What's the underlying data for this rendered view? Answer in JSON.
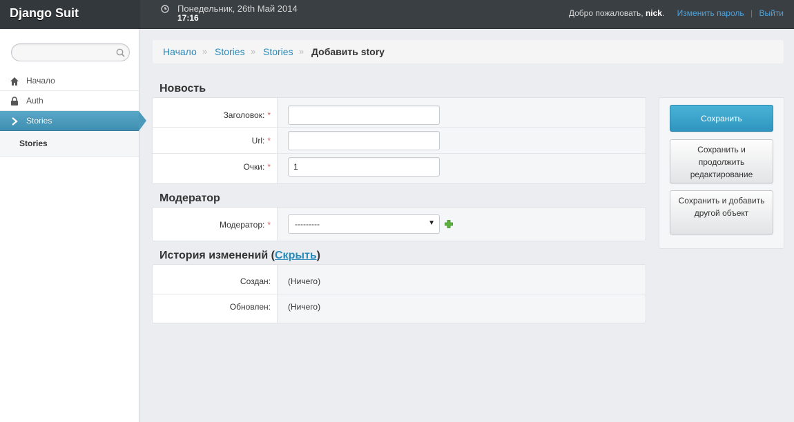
{
  "header": {
    "brand": "Django Suit",
    "date": "Понедельник, 26th Май 2014",
    "time": "17:16",
    "welcome": "Добро пожаловать,",
    "username": "nick",
    "change_password": "Изменить пароль",
    "separator": "|",
    "logout": "Выйти"
  },
  "sidebar": {
    "search_placeholder": "",
    "items": [
      {
        "label": "Начало",
        "icon": "home-icon"
      },
      {
        "label": "Auth",
        "icon": "lock-icon"
      },
      {
        "label": "Stories",
        "icon": "chevron-right-icon"
      }
    ],
    "sub_items": [
      {
        "label": "Stories"
      }
    ]
  },
  "breadcrumb": {
    "items": [
      "Начало",
      "Stories",
      "Stories"
    ],
    "separator": "»",
    "current": "Добавить story"
  },
  "fieldsets": {
    "news": {
      "title": "Новость",
      "fields": [
        {
          "label": "Заголовок:",
          "value": ""
        },
        {
          "label": "Url:",
          "value": ""
        },
        {
          "label": "Очки:",
          "value": "1"
        }
      ]
    },
    "moderator": {
      "title": "Модератор",
      "field_label": "Модератор:",
      "selected": "---------"
    },
    "history": {
      "title": "История изменений",
      "toggle_link": "Скрыть",
      "rows": [
        {
          "label": "Создан:",
          "value": "(Ничего)"
        },
        {
          "label": "Обновлен:",
          "value": "(Ничего)"
        }
      ]
    },
    "required_marker": "*"
  },
  "actions": {
    "save": "Сохранить",
    "save_continue": "Сохранить и продолжить редактирование",
    "save_add": "Сохранить и добавить другой объект"
  },
  "colors": {
    "header_bg": "#3a3f44",
    "accent": "#2a8ab9",
    "primary_button": "#3ba3cb"
  }
}
